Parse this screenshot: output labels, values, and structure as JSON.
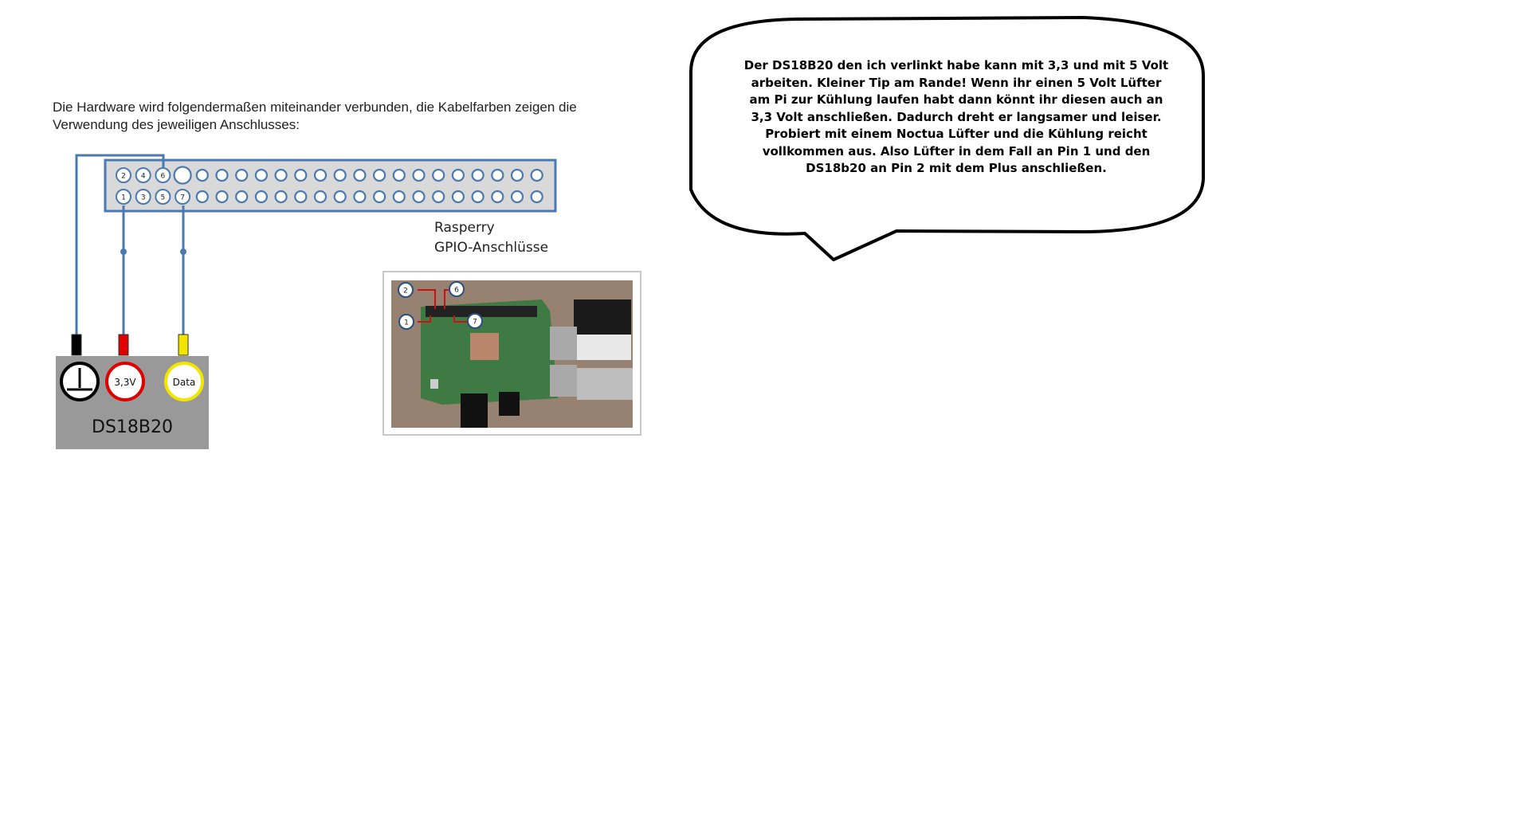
{
  "intro_text": "Die Hardware wird folgendermaßen miteinander verbunden, die Kabelfarben zeigen die Verwendung des jeweiligen Anschlusses:",
  "rpi_label_line1": "Rasperry",
  "rpi_label_line2": "GPIO-Anschlüsse",
  "header_top_pins": [
    "2",
    "4",
    "6"
  ],
  "header_bottom_pins": [
    "1",
    "3",
    "5",
    "7"
  ],
  "photo_pins": [
    "2",
    "6",
    "1",
    "7"
  ],
  "sensor": {
    "name": "DS18B20",
    "ground_symbol": "ground-icon",
    "vcc_label": "3,3V",
    "data_label": "Data"
  },
  "wire_colors": {
    "ground": "#000000",
    "vcc": "#e00000",
    "data": "#f2e600",
    "lines": "#4a7ab0"
  },
  "speech_bubble_text": "Der DS18B20 den ich verlinkt habe kann mit 3,3 und mit 5 Volt arbeiten. Kleiner Tip am Rande! Wenn ihr einen 5 Volt Lüfter am Pi zur Kühlung laufen habt dann könnt ihr diesen auch an 3,3 Volt anschließen. Dadurch dreht er langsamer und leiser. Probiert mit einem Noctua Lüfter und die Kühlung reicht vollkommen aus. Also Lüfter in dem Fall an Pin 1 und den DS18b20 an Pin 2 mit dem Plus anschließen."
}
